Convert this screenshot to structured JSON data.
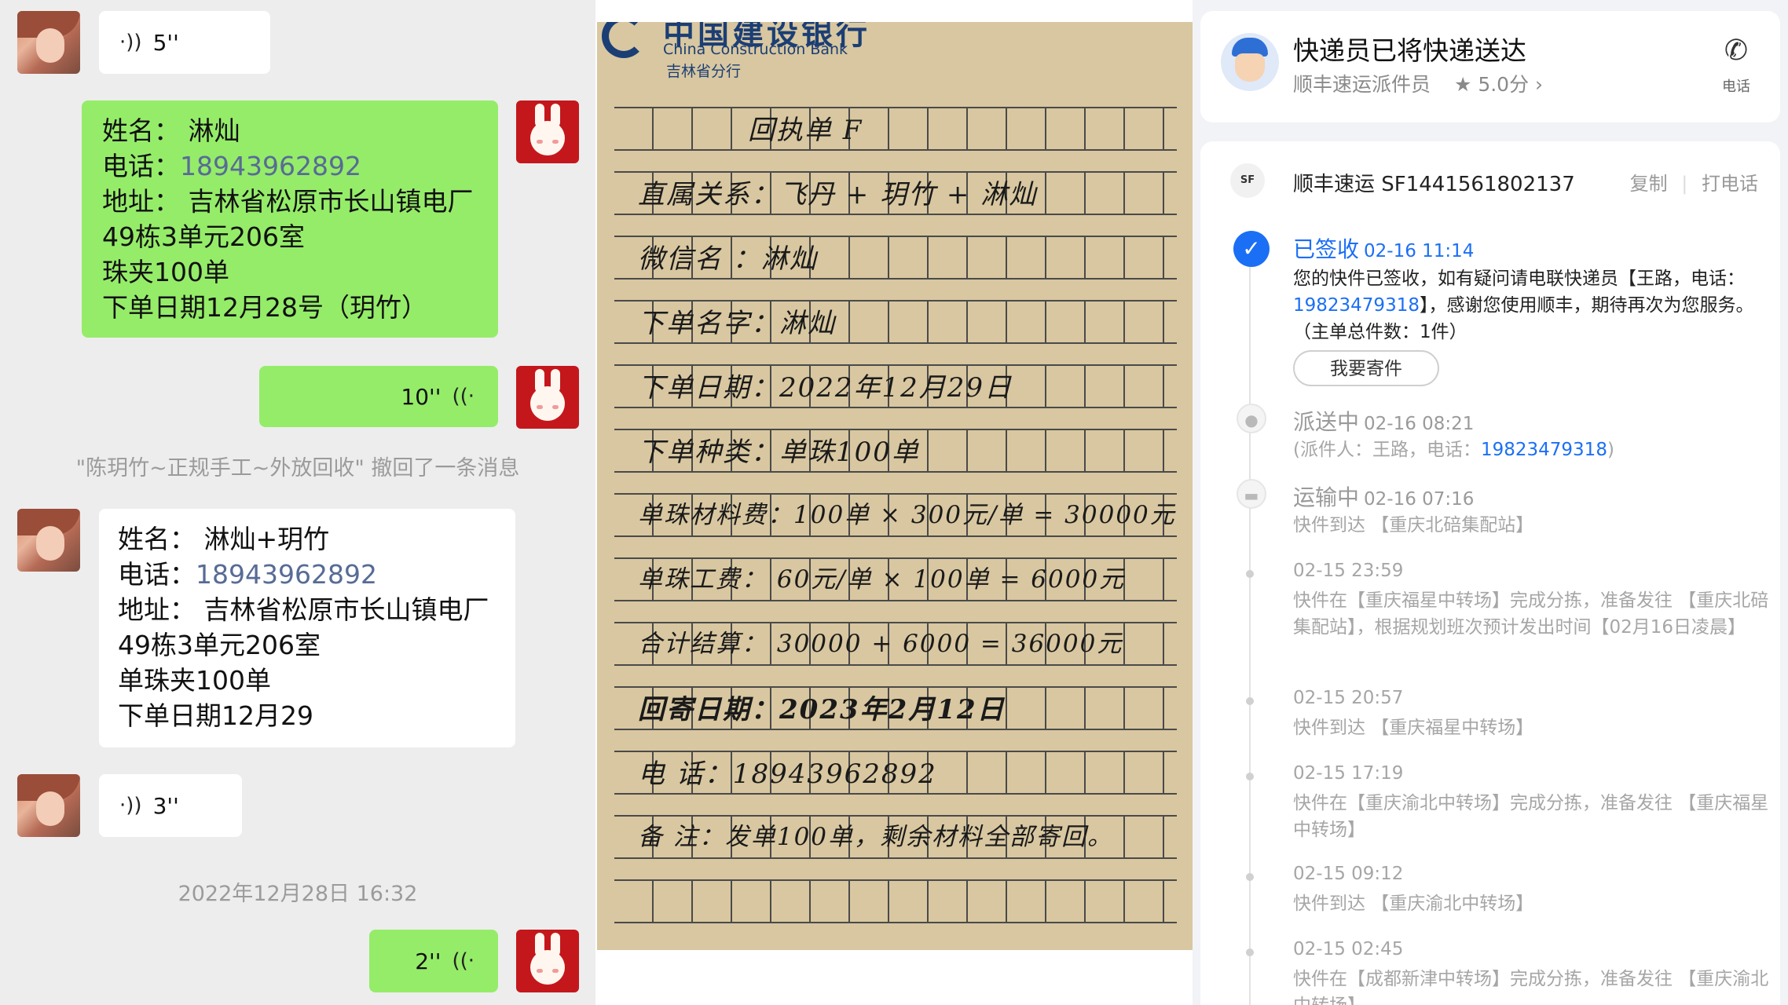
{
  "chat": {
    "voice_1": "5''",
    "order_1": {
      "name": "姓名：  淋灿",
      "phone_label": "电话：",
      "phone": "18943962892",
      "addr_1": "地址：  吉林省松原市长山镇电厂",
      "addr_2": "49栋3单元206室",
      "item": "珠夹100单",
      "date": "下单日期12月28号（玥竹）"
    },
    "voice_2": "10''",
    "recall_notice": "\"陈玥竹~正规手工~外放回收\" 撤回了一条消息",
    "order_2": {
      "name": "姓名：  淋灿+玥竹",
      "phone_label": "电话：",
      "phone": "18943962892",
      "addr_1": "地址：  吉林省松原市长山镇电厂",
      "addr_2": "49栋3单元206室",
      "item": "单珠夹100单",
      "date": "下单日期12月29"
    },
    "voice_3": "3''",
    "timestamp": "2022年12月28日 16:32",
    "voice_4": "2''"
  },
  "receipt": {
    "bank_cn": "中国建设银行",
    "bank_en": "China Construction Bank",
    "bank_branch": "吉林省分行",
    "lines": [
      "回执单   F",
      "直属关系：飞丹 + 玥竹 + 淋灿",
      "微信名  ：淋灿",
      "下单名字：淋灿",
      "下单日期：2022年12月29日",
      "下单种类：单珠100单",
      "单珠材料费：100单 × 300元/单 = 30000元",
      "单珠工费：  60元/单 × 100单 = 6000元",
      "合计结算：  30000 + 6000 = 36000元",
      "回寄日期：2023年2月12日",
      "电    话：18943962892",
      "备    注：发单100单，剩余材料全部寄回。"
    ]
  },
  "tracking": {
    "header": {
      "title": "快递员已将快递送达",
      "courier": "顺丰速运派件员",
      "rating": "★ 5.0分 ›",
      "call_label": "电话"
    },
    "waybill": {
      "logo_text": "SF",
      "text": "顺丰速运 SF1441561802137",
      "copy": "复制",
      "call": "打电话"
    },
    "signed": {
      "status": "已签收",
      "time": "02-16 11:14",
      "desc_1": "您的快件已签收，如有疑问请电联快递员【王路，电话：",
      "desc_phone": "19823479318",
      "desc_2": "】，感谢您使用顺丰，期待再次为您服务。（主单总件数：1件）",
      "button": "我要寄件"
    },
    "dispatch": {
      "status": "派送中",
      "time": "02-16 08:21",
      "desc_1": "(派件人：王路，电话：",
      "desc_phone": "19823479318",
      "desc_2": ")"
    },
    "transit": {
      "status": "运输中",
      "time": "02-16 07:16",
      "desc": "快件到达 【重庆北碚集配站】"
    },
    "events": [
      {
        "time": "02-15 23:59",
        "desc": "快件在【重庆福星中转场】完成分拣，准备发往 【重庆北碚集配站】，根据规划班次预计发出时间【02月16日凌晨】"
      },
      {
        "time": "02-15 20:57",
        "desc": "快件到达 【重庆福星中转场】"
      },
      {
        "time": "02-15 17:19",
        "desc": "快件在【重庆渝北中转场】完成分拣，准备发往 【重庆福星中转场】"
      },
      {
        "time": "02-15 09:12",
        "desc": "快件到达 【重庆渝北中转场】"
      },
      {
        "time": "02-15 02:45",
        "desc": "快件在【成都新津中转场】完成分拣，准备发往 【重庆渝北中转场】"
      }
    ],
    "colors": {
      "accent": "#1b6ff5",
      "muted": "#a6a6a6",
      "link": "#1b6ff5"
    }
  }
}
